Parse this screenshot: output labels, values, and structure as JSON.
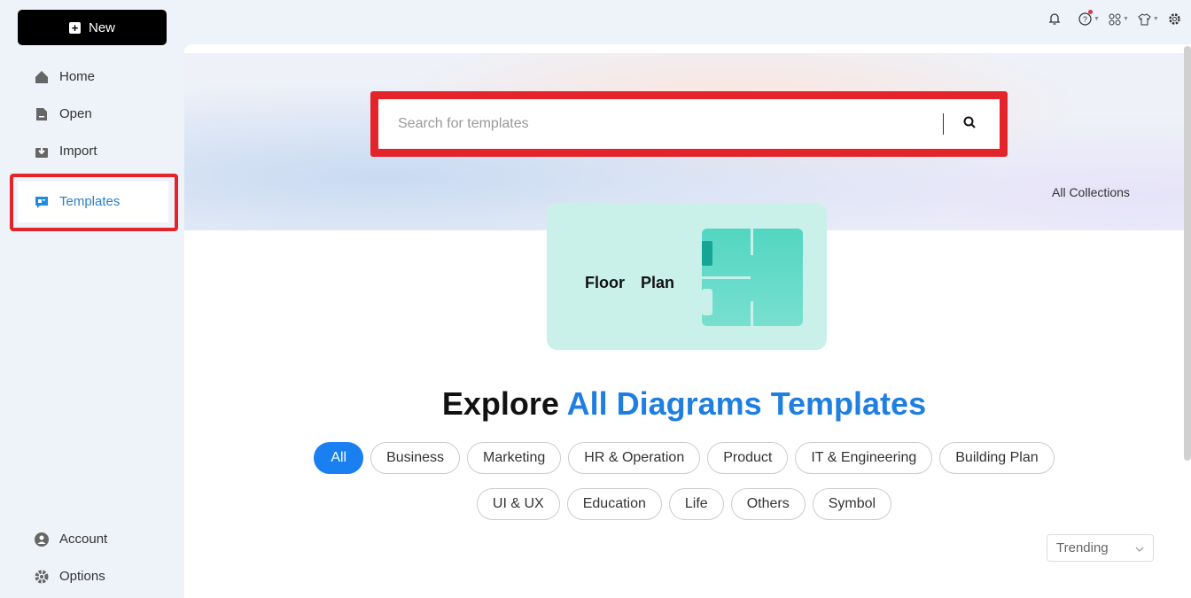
{
  "sidebar": {
    "new_label": "New",
    "items": [
      {
        "label": "Home",
        "icon": "home-icon"
      },
      {
        "label": "Open",
        "icon": "file-icon"
      },
      {
        "label": "Import",
        "icon": "import-icon"
      },
      {
        "label": "Templates",
        "icon": "templates-icon",
        "active": true
      }
    ],
    "bottom": [
      {
        "label": "Account",
        "icon": "account-icon"
      },
      {
        "label": "Options",
        "icon": "gear-icon"
      }
    ]
  },
  "topbar": {
    "icons": [
      "bell-icon",
      "help-icon",
      "apps-icon",
      "theme-icon",
      "settings-icon"
    ],
    "notification_color": "#e0323c"
  },
  "search": {
    "placeholder": "Search for templates",
    "value": ""
  },
  "all_collections": "All Collections",
  "featured": {
    "label": "Floor  Plan"
  },
  "heading": {
    "part1": "Explore ",
    "part2": "All Diagrams Templates"
  },
  "categories": [
    "All",
    "Business",
    "Marketing",
    "HR & Operation",
    "Product",
    "IT & Engineering",
    "Building Plan",
    "UI & UX",
    "Education",
    "Life",
    "Others",
    "Symbol"
  ],
  "selected_category": "All",
  "sort": {
    "value": "Trending"
  },
  "colors": {
    "accent": "#1a7ff0",
    "highlight": "#e3242b",
    "card": "#c9f1ea"
  }
}
